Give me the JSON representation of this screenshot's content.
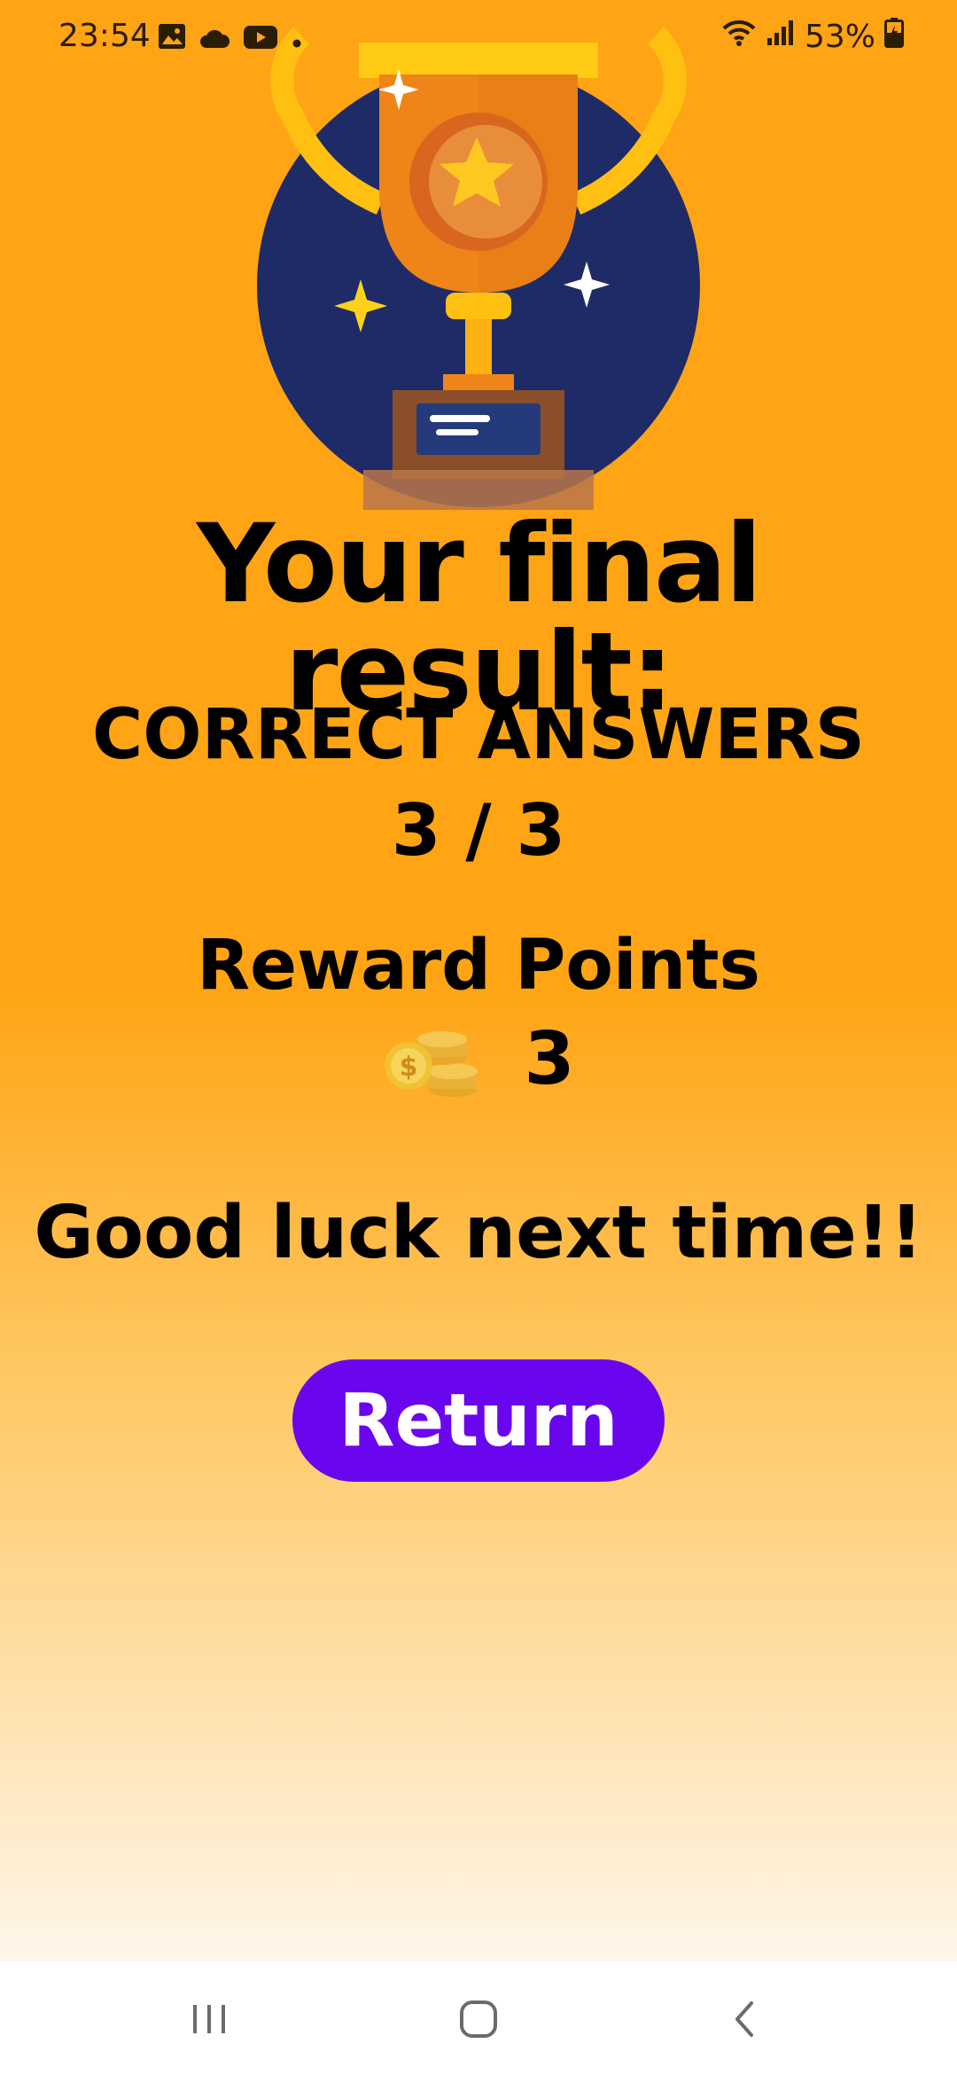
{
  "status_bar": {
    "time": "23:54",
    "battery": "53%",
    "left_icons": [
      "gallery-icon",
      "cloud-icon",
      "youtube-icon",
      "dot-icon"
    ],
    "right_icons": [
      "wifi-icon",
      "signal-icon",
      "battery-charging-icon"
    ]
  },
  "result": {
    "title": "Your final result:",
    "correct_label": "CORRECT ANSWERS",
    "correct_value": "3 / 3",
    "reward_label": "Reward Points",
    "reward_value": "3",
    "message": "Good luck next time!!"
  },
  "actions": {
    "return_label": "Return"
  },
  "nav_bar": {
    "buttons": [
      "recent-apps-icon",
      "home-icon",
      "back-icon"
    ]
  },
  "colors": {
    "background_top": "#ffa414",
    "background_bottom": "#fff6ea",
    "button": "#6a06ee",
    "trophy_circle": "#1e2b66"
  }
}
